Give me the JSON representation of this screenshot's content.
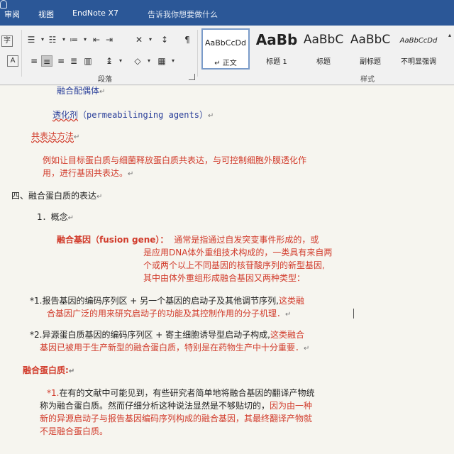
{
  "menu": {
    "items": [
      "审阅",
      "视图",
      "EndNote X7"
    ],
    "tell_me": "告诉我你想要做什么"
  },
  "ribbon": {
    "paragraph_group_label": "段落",
    "styles_group_label": "样式",
    "styles": [
      {
        "sample": "AaBbCcDd",
        "name": "↵ 正文",
        "active": true
      },
      {
        "sample": "AaBb",
        "name": "标题 1"
      },
      {
        "sample": "AaBbC",
        "name": "标题"
      },
      {
        "sample": "AaBbC",
        "name": "副标题"
      },
      {
        "sample": "AaBbCcDd",
        "name": "不明显强调"
      }
    ],
    "left_icons": [
      "字",
      "A"
    ]
  },
  "document": {
    "line1": "融合配偶体",
    "line2_text": "透化剂",
    "line2_paren": "（permeabilinging agents）",
    "coexpr_heading": "共表达方法",
    "coexpr_body_1": "例如让目标蛋白质与细菌释放蛋白质共表达，与可控制细胞外膜透化作",
    "coexpr_body_2": "用，进行基因共表达。",
    "section4": "四、融合蛋白质的表达",
    "concept": "1．概念",
    "fusion_term": "融合基因（fusion gene）：",
    "fusion_def_1": "通常是指通过自发突变事件形成的，或",
    "fusion_def_2": "是应用DNA体外重组技术构成的，一类具有来自两",
    "fusion_def_3": "个或两个以上不同基因的核苷酸序列的新型基因,",
    "fusion_def_4": "其中由体外重组形成融合基因又两种类型：",
    "item1_black": "*1.报告基因的编码序列区 + 另一个基因的启动子及其他调节序列,",
    "item1_red_a": "这类融",
    "item1_red_b": "合基因广泛的用来研究启动子的功能及其控制作用的分子机理．",
    "item2_black": "*2.异源蛋白质基因的编码序列区 + 寄主细胞诱导型启动子构成,",
    "item2_red_a": "这类融合",
    "item2_red_b": "基因已被用于生产新型的融合蛋白质，特别是在药物生产中十分重要．",
    "fusion_protein_heading": "融合蛋白质:",
    "fp_star": "*1.",
    "fp_line1": "在有的文献中可能见到，有些研究者简单地将融合基因的翻译产物统",
    "fp_line2": "称为融合蛋白质。然而仔细分析这种说法显然是不够贴切的，",
    "fp_line2_red": "因为由一种",
    "fp_line3": "新的异源启动子与报告基因编码序列构成的融合基因，其最终翻译产物就",
    "fp_line4": "不是融合蛋白质。"
  },
  "colors": {
    "accent": "#2b5797",
    "red_text": "#d13b2b",
    "blue_text": "#2a3f9a"
  }
}
